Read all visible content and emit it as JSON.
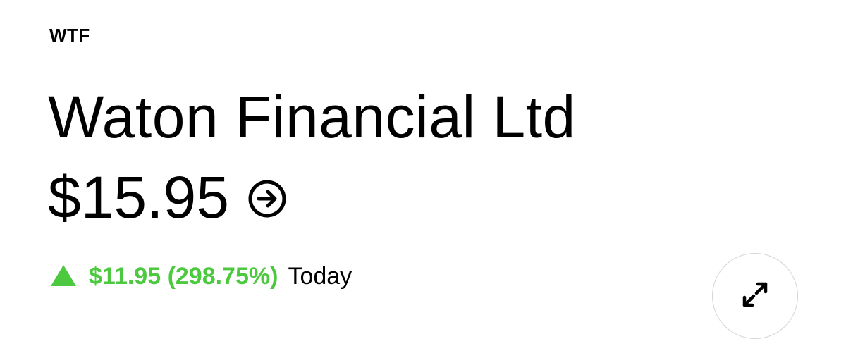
{
  "stock": {
    "ticker": "WTF",
    "company_name": "Waton Financial Ltd",
    "price": "$15.95",
    "change": {
      "amount_and_percent": "$11.95 (298.75%)",
      "period": "Today",
      "direction": "up",
      "color": "#4cc93f"
    }
  },
  "icons": {
    "price_arrow": "arrow-right-circle-icon",
    "expand": "expand-icon"
  }
}
